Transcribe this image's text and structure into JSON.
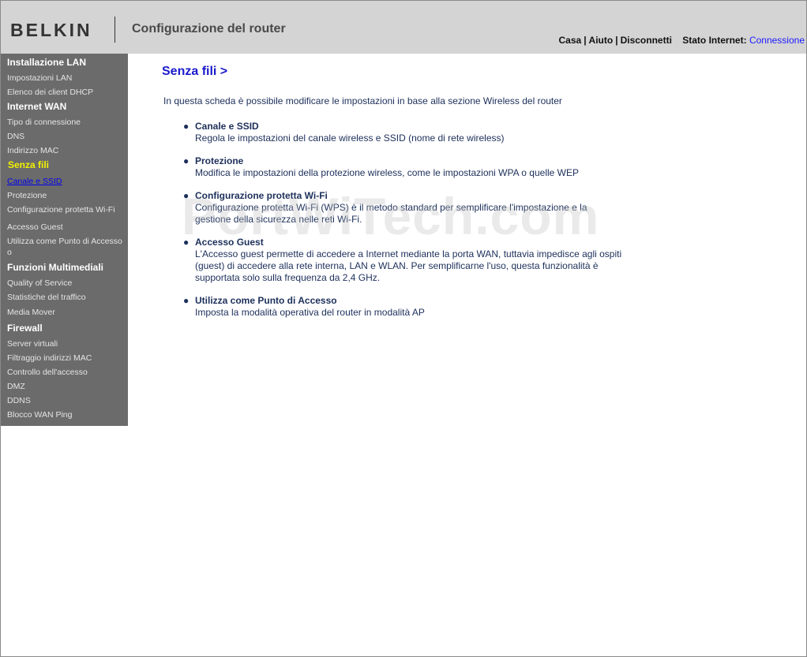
{
  "header": {
    "brand": "BELKIN",
    "title": "Configurazione del router",
    "links": {
      "home": "Casa",
      "sep1": "|",
      "help": "Aiuto",
      "sep2": "|",
      "logout": "Disconnetti"
    },
    "status_label": "Stato Internet:",
    "status_value": "Connessione"
  },
  "sidebar": {
    "lan": {
      "title": "Installazione LAN",
      "items": [
        "Impostazioni LAN",
        "Elenco dei client DHCP"
      ]
    },
    "wan": {
      "title": "Internet WAN",
      "items": [
        "Tipo di connessione",
        "DNS",
        "Indirizzo MAC"
      ]
    },
    "wireless": {
      "title": "Senza fili",
      "items": [
        "Canale e SSID",
        "Protezione",
        "Configurazione protetta Wi-Fi",
        "Accesso Guest",
        "Utilizza come Punto di Accesso",
        "o"
      ]
    },
    "media": {
      "title": "Funzioni Multimediali",
      "items": [
        "Quality of Service",
        "Statistiche del traffico",
        "Media Mover"
      ]
    },
    "firewall": {
      "title": "Firewall",
      "items": [
        "Server virtuali",
        "Filtraggio indirizzi MAC",
        "Controllo dell'accesso",
        "DMZ",
        "DDNS",
        "Blocco WAN Ping"
      ]
    }
  },
  "main": {
    "title": "Senza fili >",
    "intro": "In questa scheda è possibile modificare le impostazioni in base alla sezione Wireless del router",
    "features": [
      {
        "title": "Canale e SSID",
        "lines": [
          "Regola le impostazioni del canale wireless e SSID (nome di rete wireless)"
        ]
      },
      {
        "title": "Protezione",
        "lines": [
          "Modifica le impostazioni della protezione wireless, come le impostazioni WPA o quelle WEP"
        ]
      },
      {
        "title": "Configurazione protetta Wi-Fi",
        "lines": [
          "Configurazione protetta Wi-Fi (WPS) è il metodo standard per semplificare l'impostazione e la",
          "gestione della sicurezza nelle reti Wi-Fi."
        ]
      },
      {
        "title": "Accesso Guest",
        "lines": [
          "L'Accesso guest permette di accedere a Internet mediante la porta WAN, tuttavia impedisce agli ospiti",
          "(guest) di accedere alla rete interna, LAN e WLAN. Per semplificarne l'uso, questa funzionalità è",
          "supportata solo sulla frequenza da 2,4 GHz."
        ]
      },
      {
        "title": "Utilizza come Punto di Accesso",
        "lines": [
          "Imposta la modalità operativa del router in modalità AP"
        ]
      }
    ]
  },
  "watermark": "PortWiTech.com",
  "colors": {
    "sidebar_bg": "#6b6b6b",
    "header_bg": "#d4d4d4",
    "active_section": "#f2f200",
    "title_blue": "#1a1acc",
    "text_navy": "#1c2f5a"
  }
}
